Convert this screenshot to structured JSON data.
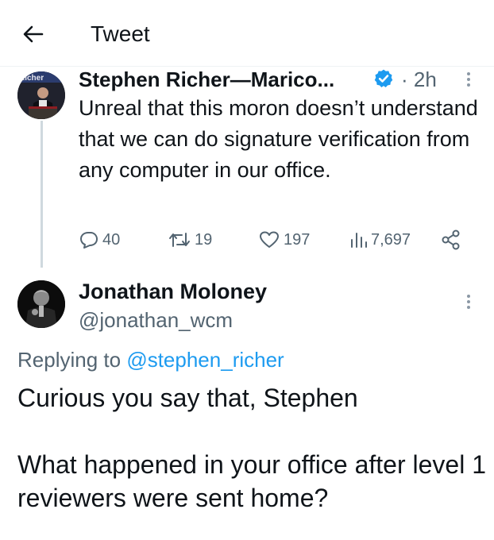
{
  "header": {
    "title": "Tweet",
    "back_icon": "arrow-left-icon"
  },
  "parent_tweet": {
    "author_name": "Stephen Richer—Marico...",
    "verified": true,
    "verified_color": "#1d9bf0",
    "separator": "·",
    "time": "2h",
    "avatar_text": "Richer",
    "text": "Unreal that this moron doesn’t understand that we can do signature verification from any computer in our office.",
    "stats": {
      "replies": "40",
      "retweets": "19",
      "likes": "197",
      "views": "7,697"
    }
  },
  "reply_tweet": {
    "author_name": "Jonathan Moloney",
    "handle": "@jonathan_wcm",
    "replying_label": "Replying to ",
    "replying_handle": "@stephen_richer",
    "text_line_1": "Curious you say that, Stephen",
    "text_line_2": "What happened in your office after level 1 reviewers were sent home?"
  },
  "colors": {
    "text": "#0f1419",
    "secondary": "#536471",
    "accent": "#1d9bf0",
    "thread_line": "#cfd9de"
  }
}
